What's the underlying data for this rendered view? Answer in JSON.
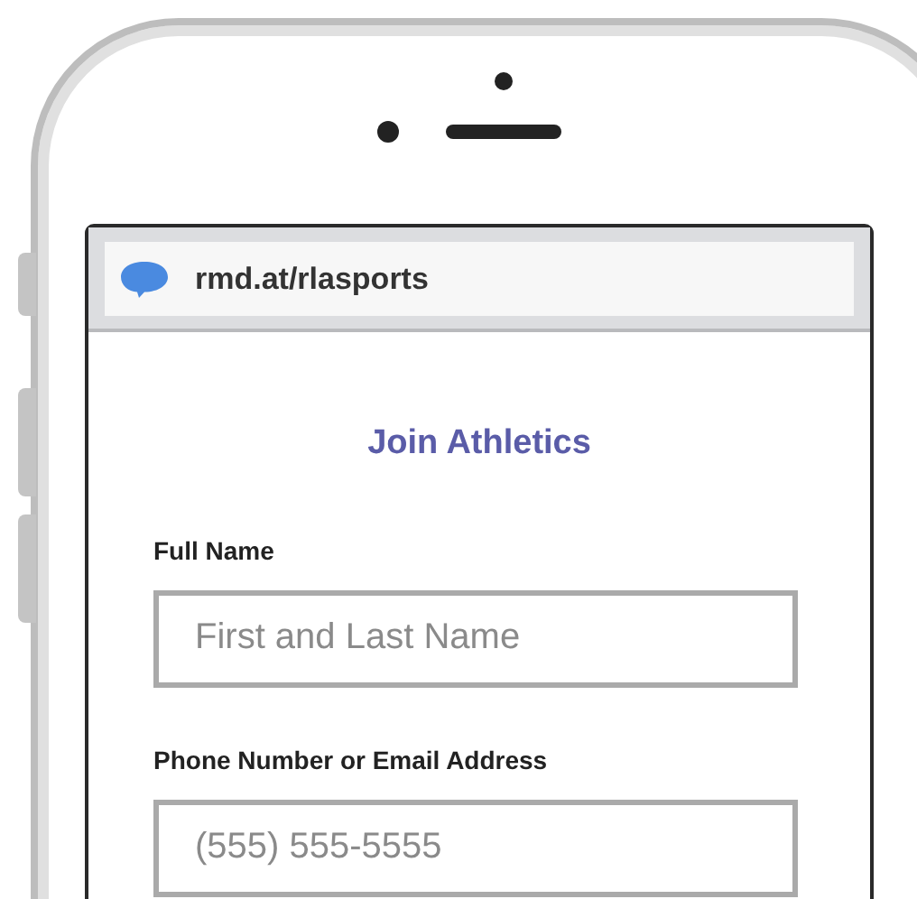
{
  "address_bar": {
    "url": "rmd.at/rlasports"
  },
  "form": {
    "title": "Join Athletics",
    "fields": [
      {
        "label": "Full Name",
        "placeholder": "First and Last Name"
      },
      {
        "label": "Phone Number or Email Address",
        "placeholder": "(555) 555-5555"
      }
    ]
  }
}
